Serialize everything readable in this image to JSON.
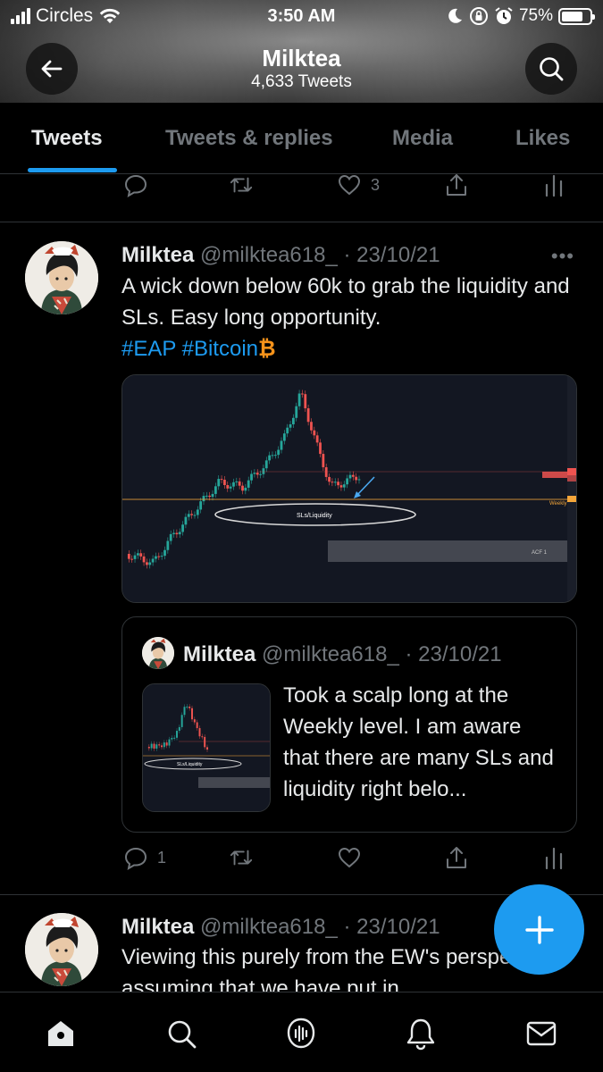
{
  "status_bar": {
    "carrier": "Circles",
    "time": "3:50 AM",
    "battery": "75%",
    "battery_level": 0.75
  },
  "profile": {
    "name": "Milktea",
    "tweet_count": "4,633 Tweets"
  },
  "tabs": [
    {
      "label": "Tweets",
      "active": true
    },
    {
      "label": "Tweets & replies",
      "active": false
    },
    {
      "label": "Media",
      "active": false
    },
    {
      "label": "Likes",
      "active": false
    }
  ],
  "top_actions": {
    "reply_count": "",
    "retweet_count": "",
    "like_count": "3"
  },
  "tweet1": {
    "name": "Milktea",
    "handle": "@milktea618_",
    "date": "· 23/10/21",
    "text": "A wick down below 60k to grab the liquidity and SLs. Easy long opportunity.",
    "hashtags": [
      "#EAP",
      "#Bitcoin"
    ],
    "bitcoin_emoji": "₿",
    "more": "•••",
    "chart_labels": {
      "zone": "SLs/Liquidity",
      "weekly": "Weekly",
      "acf": "ACF 1"
    },
    "quote": {
      "name": "Milktea",
      "handle": "@milktea618_",
      "date": "· 23/10/21",
      "text": "Took a scalp long at the Weekly level. I am aware that there are many SLs and liquidity right belo...",
      "thumb_label": "SLs/Liquidity"
    },
    "actions": {
      "reply_count": "1",
      "retweet_count": "",
      "like_count": ""
    }
  },
  "tweet2": {
    "name": "Milktea",
    "handle": "@milktea618_",
    "date": "· 23/10/21",
    "text": "Viewing this purely from the EW's perspective, assuming that we have put in",
    "more": "•••"
  },
  "colors": {
    "accent": "#1d9bf0",
    "bitcoin": "#f7931a",
    "candle_up": "#26a69a",
    "candle_down": "#ef5350"
  },
  "bottom_nav": [
    "home-icon",
    "search-icon",
    "spaces-icon",
    "notifications-icon",
    "messages-icon"
  ]
}
